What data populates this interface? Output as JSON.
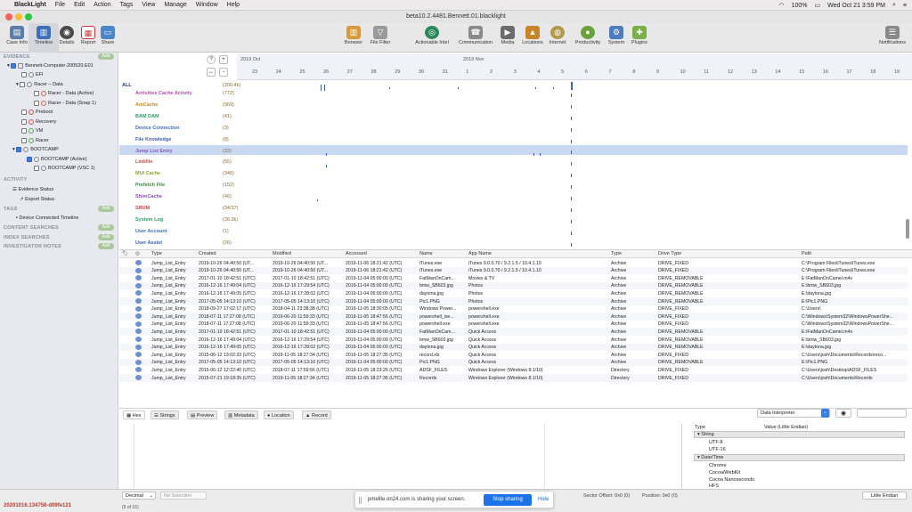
{
  "menubar": {
    "app": "BlackLight",
    "items": [
      "File",
      "Edit",
      "Action",
      "Tags",
      "View",
      "Manage",
      "Window",
      "Help"
    ],
    "right": [
      "100%",
      "Wed Oct 21  3:59 PM"
    ]
  },
  "window": {
    "title": "beta10.2.4481.Bennett.01.blacklight"
  },
  "toolbar": {
    "left": [
      {
        "label": "Case Info",
        "icon": "case-info-icon",
        "color": "#5b7ea8"
      },
      {
        "label": "Timeline",
        "icon": "timeline-icon",
        "color": "#3e6fb8"
      },
      {
        "label": "Details",
        "icon": "details-icon",
        "color": "#4a4a4a"
      },
      {
        "label": "Report",
        "icon": "report-icon",
        "color": "#c33"
      },
      {
        "label": "Share",
        "icon": "share-icon",
        "color": "#4a86c9"
      }
    ],
    "right": [
      {
        "label": "Browser",
        "icon": "browser-icon",
        "color": "#d69a3a"
      },
      {
        "label": "File Filter",
        "icon": "file-filter-icon",
        "color": "#9a9a9a"
      },
      {
        "label": "Actionable Intel",
        "icon": "actionable-intel-icon",
        "color": "#2c8a5a"
      },
      {
        "label": "Communication",
        "icon": "communication-icon",
        "color": "#8a8a8a"
      },
      {
        "label": "Media",
        "icon": "media-icon",
        "color": "#6c6c6c"
      },
      {
        "label": "Locations",
        "icon": "locations-icon",
        "color": "#c9842a"
      },
      {
        "label": "Internet",
        "icon": "internet-icon",
        "color": "#b09a4a"
      },
      {
        "label": "Productivity",
        "icon": "productivity-icon",
        "color": "#6aa23a"
      },
      {
        "label": "System",
        "icon": "system-icon",
        "color": "#4a7ec0"
      },
      {
        "label": "Plugins",
        "icon": "plugins-icon",
        "color": "#7ab04a"
      }
    ],
    "notifications": "Notifications"
  },
  "sidebar": {
    "evidence_header": "EVIDENCE",
    "evidence_badge": "Add",
    "tree": [
      "Bennett-Computer-200520.E01",
      "EFI",
      "Racer – Data",
      "Racer - Data (Active)",
      "Racer - Data (Snap 1)",
      "Preboot",
      "Recovery",
      "VM",
      "Racer",
      "BOOTCAMP",
      "BOOTCAMP (Active)",
      "BOOTCAMP (VSC 1)"
    ],
    "activity_header": "ACTIVITY",
    "activity": [
      "Evidence Status",
      "Export Status"
    ],
    "tags_header": "TAGS",
    "tags": [
      "Device Connected Timeline"
    ],
    "content_searches": "CONTENT SEARCHES",
    "index_searches": "INDEX SEARCHES",
    "investigator_notes": "INVESTIGATOR NOTES",
    "add_label": "Add"
  },
  "timeline": {
    "months": [
      "2019 Oct",
      "2019 Nov"
    ],
    "days": [
      "23",
      "24",
      "25",
      "26",
      "27",
      "28",
      "29",
      "30",
      "31",
      "1",
      "2",
      "3",
      "4",
      "5",
      "6",
      "7",
      "8",
      "9",
      "10",
      "11",
      "12",
      "13",
      "14",
      "15",
      "16",
      "17",
      "18",
      "19"
    ],
    "all_label": "ALL",
    "all_count": "(200.4k)",
    "rows": [
      {
        "label": "Activities Cache Activity",
        "count": "(772)",
        "color": "#b44fb2"
      },
      {
        "label": "AmCache",
        "count": "(969)",
        "color": "#c78a1d"
      },
      {
        "label": "BAM DAM",
        "count": "(41)",
        "color": "#2d9a6a"
      },
      {
        "label": "Device Connection",
        "count": "(3)",
        "color": "#3f6fb8"
      },
      {
        "label": "File Knowledge",
        "count": "(8)",
        "color": "#3a5fae"
      },
      {
        "label": "Jump List Entry",
        "count": "(33)",
        "color": "#8a55c4"
      },
      {
        "label": "Linkfile",
        "count": "(55)",
        "color": "#c34a4a"
      },
      {
        "label": "MUI Cache",
        "count": "(346)",
        "color": "#8da634"
      },
      {
        "label": "Prefetch File",
        "count": "(152)",
        "color": "#3c8b3c"
      },
      {
        "label": "ShimCache",
        "count": "(46)",
        "color": "#8a4fb0"
      },
      {
        "label": "SRUM",
        "count": "(34/37)",
        "color": "#c84a4a"
      },
      {
        "label": "System Log",
        "count": "(26.3k)",
        "color": "#2d9a6a"
      },
      {
        "label": "User Account",
        "count": "(1)",
        "color": "#3f6fb8"
      },
      {
        "label": "User Assist",
        "count": "(26)",
        "color": "#3a5fae"
      }
    ]
  },
  "list": {
    "columns": [
      "Type",
      "Created",
      "Modified",
      "Accessed",
      "Name",
      "App Name",
      "Type",
      "Drive Type",
      "Path"
    ],
    "rows": [
      [
        "Jump_List_Entry",
        "2019-10-26 04:40:50 (UT...",
        "2019-10-26 04:40:50 (UT...",
        "2019-11-06 18:21:42 (UTC)",
        "iTunes.exe",
        "iTunes 9.0.0.70 / 9.2.1.5 / 10.4.1.10",
        "Archive",
        "DRIVE_FIXED",
        "C:\\Program Files\\iTunes\\iTunes.exe"
      ],
      [
        "Jump_List_Entry",
        "2019-10-26 04:40:50 (UT...",
        "2019-10-26 04:40:50 (UT...",
        "2019-11-06 18:21:42 (UTC)",
        "iTunes.exe",
        "iTunes 9.0.0.70 / 9.2.1.5 / 10.4.1.10",
        "Archive",
        "DRIVE_FIXED",
        "C:\\Program Files\\iTunes\\iTunes.exe"
      ],
      [
        "Jump_List_Entry",
        "2017-01-10 18:42:51 (UTC)",
        "2017-01-10 18:42:51 (UTC)",
        "2019-11-04 05:00:00 (UTC)",
        "FatManOnCam...",
        "Movies & TV",
        "Archive",
        "DRIVE_REMOVABLE",
        "E:\\FatManOnCamel.m4v"
      ],
      [
        "Jump_List_Entry",
        "2016-12-16 17:49:04 (UTC)",
        "2016-12-16 17:29:54 (UTC)",
        "2019-11-04 05:00:00 (UTC)",
        "bmw_SB603.jpg",
        "Photos",
        "Archive",
        "DRIVE_REMOVABLE",
        "E:\\bmw_SB603.jpg"
      ],
      [
        "Jump_List_Entry",
        "2016-12-16 17:49:05 (UTC)",
        "2016-12-16 17:28:02 (UTC)",
        "2019-11-04 05:00:00 (UTC)",
        "daytona.jpg",
        "Photos",
        "Archive",
        "DRIVE_REMOVABLE",
        "E:\\daytona.jpg"
      ],
      [
        "Jump_List_Entry",
        "2017-05-05 14:13:10 (UTC)",
        "2017-05-05 14:13:10 (UTC)",
        "2019-11-04 05:00:00 (UTC)",
        "Pic1.PNG",
        "Photos",
        "Archive",
        "DRIVE_REMOVABLE",
        "E:\\Pic1.PNG"
      ],
      [
        "Jump_List_Entry",
        "2018-09-27 17:02:17 (UTC)",
        "2018-04-11 23:38:38 (UTC)",
        "2019-11-05 18:30:05 (UTC)",
        "Windows Power...",
        "powershell.exe",
        "Archive",
        "DRIVE_FIXED",
        "C:\\Users\\"
      ],
      [
        "Jump_List_Entry",
        "2018-07-11 17:27:08 (UTC)",
        "2019-06-20 11:59:33 (UTC)",
        "2019-11-05 18:47:56 (UTC)",
        "powershell_ise...",
        "powershell.exe",
        "Archive",
        "DRIVE_FIXED",
        "C:\\Windows\\System32\\WindowsPowerShe..."
      ],
      [
        "Jump_List_Entry",
        "2018-07-11 17:27:08 (UTC)",
        "2019-06-20 11:59:33 (UTC)",
        "2019-11-05 18:47:56 (UTC)",
        "powershell.exe",
        "powershell.exe",
        "Archive",
        "DRIVE_FIXED",
        "C:\\Windows\\System32\\WindowsPowerShe..."
      ],
      [
        "Jump_List_Entry",
        "2017-01-10 18:42:51 (UTC)",
        "2017-01-10 18:42:51 (UTC)",
        "2019-11-04 05:00:00 (UTC)",
        "FatManOnCam...",
        "Quick Access",
        "Archive",
        "DRIVE_REMOVABLE",
        "E:\\FatManOnCamel.m4v"
      ],
      [
        "Jump_List_Entry",
        "2016-12-16 17:49:04 (UTC)",
        "2016-12-16 17:29:54 (UTC)",
        "2019-11-04 05:00:00 (UTC)",
        "bmw_SB603.jpg",
        "Quick Access",
        "Archive",
        "DRIVE_REMOVABLE",
        "E:\\bmw_SB603.jpg"
      ],
      [
        "Jump_List_Entry",
        "2016-12-16 17:49:05 (UTC)",
        "2016-12-16 17:28:02 (UTC)",
        "2019-11-04 05:00:00 (UTC)",
        "daytona.jpg",
        "Quick Access",
        "Archive",
        "DRIVE_REMOVABLE",
        "E:\\daytona.jpg"
      ],
      [
        "Jump_List_Entry",
        "2015-06-12 13:02:33 (UTC)",
        "2019-11-05 18:27:34 (UTC)",
        "2019-11-05 18:27:35 (UTC)",
        "record.xls",
        "Quick Access",
        "Archive",
        "DRIVE_FIXED",
        "C:\\Users\\josh\\Documents\\Records\\reco..."
      ],
      [
        "Jump_List_Entry",
        "2017-05-05 14:13:10 (UTC)",
        "2017-05-05 14:13:10 (UTC)",
        "2019-11-04 05:00:00 (UTC)",
        "Pic1.PNG",
        "Quick Access",
        "Archive",
        "DRIVE_REMOVABLE",
        "E:\\Pic1.PNG"
      ],
      [
        "Jump_List_Entry",
        "2015-06-12 12:22:40 (UTC)",
        "2018-07-11 17:59:56 (UTC)",
        "2019-11-05 18:23:26 (UTC)",
        "ADSF_FILES",
        "Windows Explorer (Windows 8.1/10)",
        "Directory",
        "DRIVE_FIXED",
        "C:\\Users\\josh\\Desktop\\ADSF_FILES"
      ],
      [
        "Jump_List_Entry",
        "2015-07-21 19:18:35 (UTC)",
        "2019-11-05 18:27:34 (UTC)",
        "2019-11-05 18:27:36 (UTC)",
        "Records",
        "Windows Explorer (Windows 8.1/10)",
        "Directory",
        "DRIVE_FIXED",
        "C:\\Users\\josh\\Documents\\Records"
      ]
    ]
  },
  "bottom": {
    "tabs": [
      "Hex",
      "Strings",
      "Preview",
      "Metadata",
      "Location",
      "Record"
    ],
    "interpreter": "Data Interpreter",
    "interp_header": [
      "Type",
      "Value (Little Endian)"
    ],
    "interp_items": [
      "String",
      "UTF-8",
      "UTF-16",
      "Date/Time",
      "Chrome",
      "Cocoa/WebKit",
      "Cocoa Nanoseconds",
      "HFS"
    ],
    "decimal": "Decimal",
    "no_selection": "No Selection",
    "sector_offset": "Sector Offset: 0x0 (0)",
    "position": "Position: 0x0 (0)",
    "endian": "Little Endian"
  },
  "status": {
    "id_text": "20201016.134758-d09fe121",
    "count_text": "(5 of 16)"
  },
  "share": {
    "text": "pmelite.on24.com is sharing your screen.",
    "stop": "Stop sharing",
    "hide": "Hide"
  }
}
